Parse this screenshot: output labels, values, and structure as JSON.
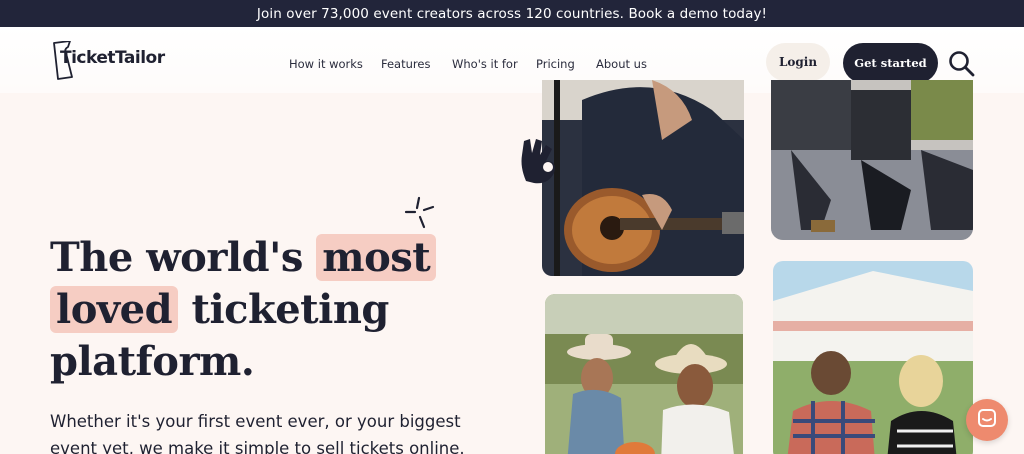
{
  "announcement": "Join over 73,000 event creators across 120 countries. Book a demo today!",
  "brand": {
    "name": "TicketTailor"
  },
  "nav": {
    "links": [
      "How it works",
      "Features",
      "Who's it for",
      "Pricing",
      "About us"
    ],
    "login": "Login",
    "get_started": "Get started"
  },
  "hero": {
    "title_part1": "The world's",
    "title_highlight1": "most",
    "title_highlight2": "loved",
    "title_part2": "ticketing",
    "title_part3": "platform.",
    "subtitle": "Whether it's your first event ever, or your biggest event yet, we make it simple to sell tickets online."
  },
  "colors": {
    "dark": "#1f2131",
    "highlight": "#f6cdc3",
    "accent": "#ee8a6e",
    "background": "#fdf6f3"
  },
  "icons": [
    "search-icon",
    "sparkle-icon",
    "ok-hand-icon",
    "chat-icon"
  ]
}
